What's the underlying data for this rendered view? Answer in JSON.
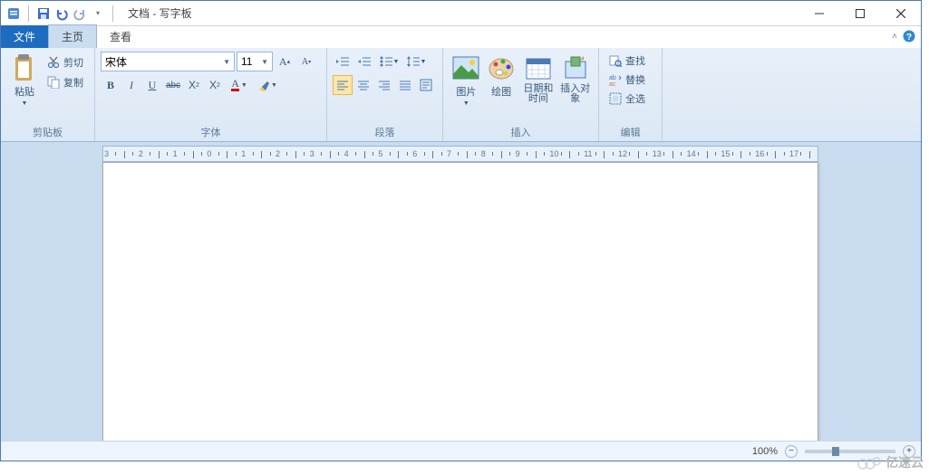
{
  "title": "文档 - 写字板",
  "tabs": {
    "file": "文件",
    "home": "主页",
    "view": "查看"
  },
  "ribbon": {
    "clipboard": {
      "label": "剪贴板",
      "paste": "粘贴",
      "cut": "剪切",
      "copy": "复制"
    },
    "font": {
      "label": "字体",
      "family": "宋体",
      "size": "11"
    },
    "paragraph": {
      "label": "段落"
    },
    "insert": {
      "label": "插入",
      "picture": "图片",
      "paint": "绘图",
      "datetime": "日期和时间",
      "object": "插入对象"
    },
    "editing": {
      "label": "编辑",
      "find": "查找",
      "replace": "替换",
      "selectall": "全选"
    }
  },
  "ruler": {
    "start": -3,
    "end": 17
  },
  "status": {
    "zoom": "100%"
  },
  "watermark": "亿速云"
}
